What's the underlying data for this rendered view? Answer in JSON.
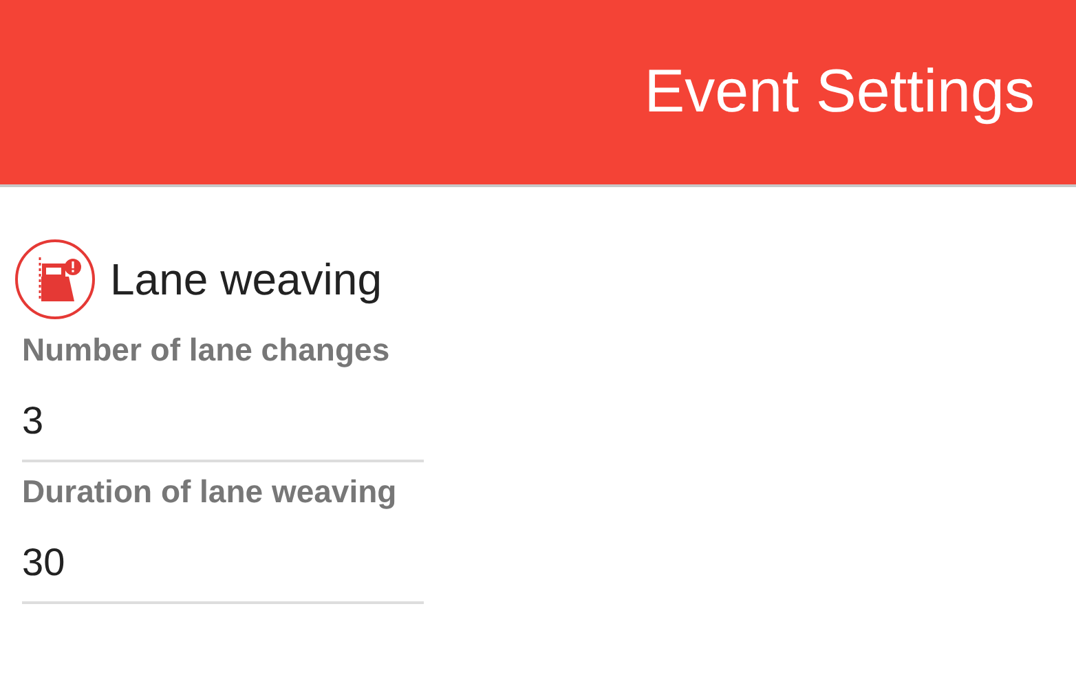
{
  "header": {
    "title": "Event Settings"
  },
  "event": {
    "name": "Lane weaving"
  },
  "fields": [
    {
      "label": "Number of lane changes",
      "value": "3"
    },
    {
      "label": "Duration of lane weaving",
      "value": "30"
    }
  ]
}
